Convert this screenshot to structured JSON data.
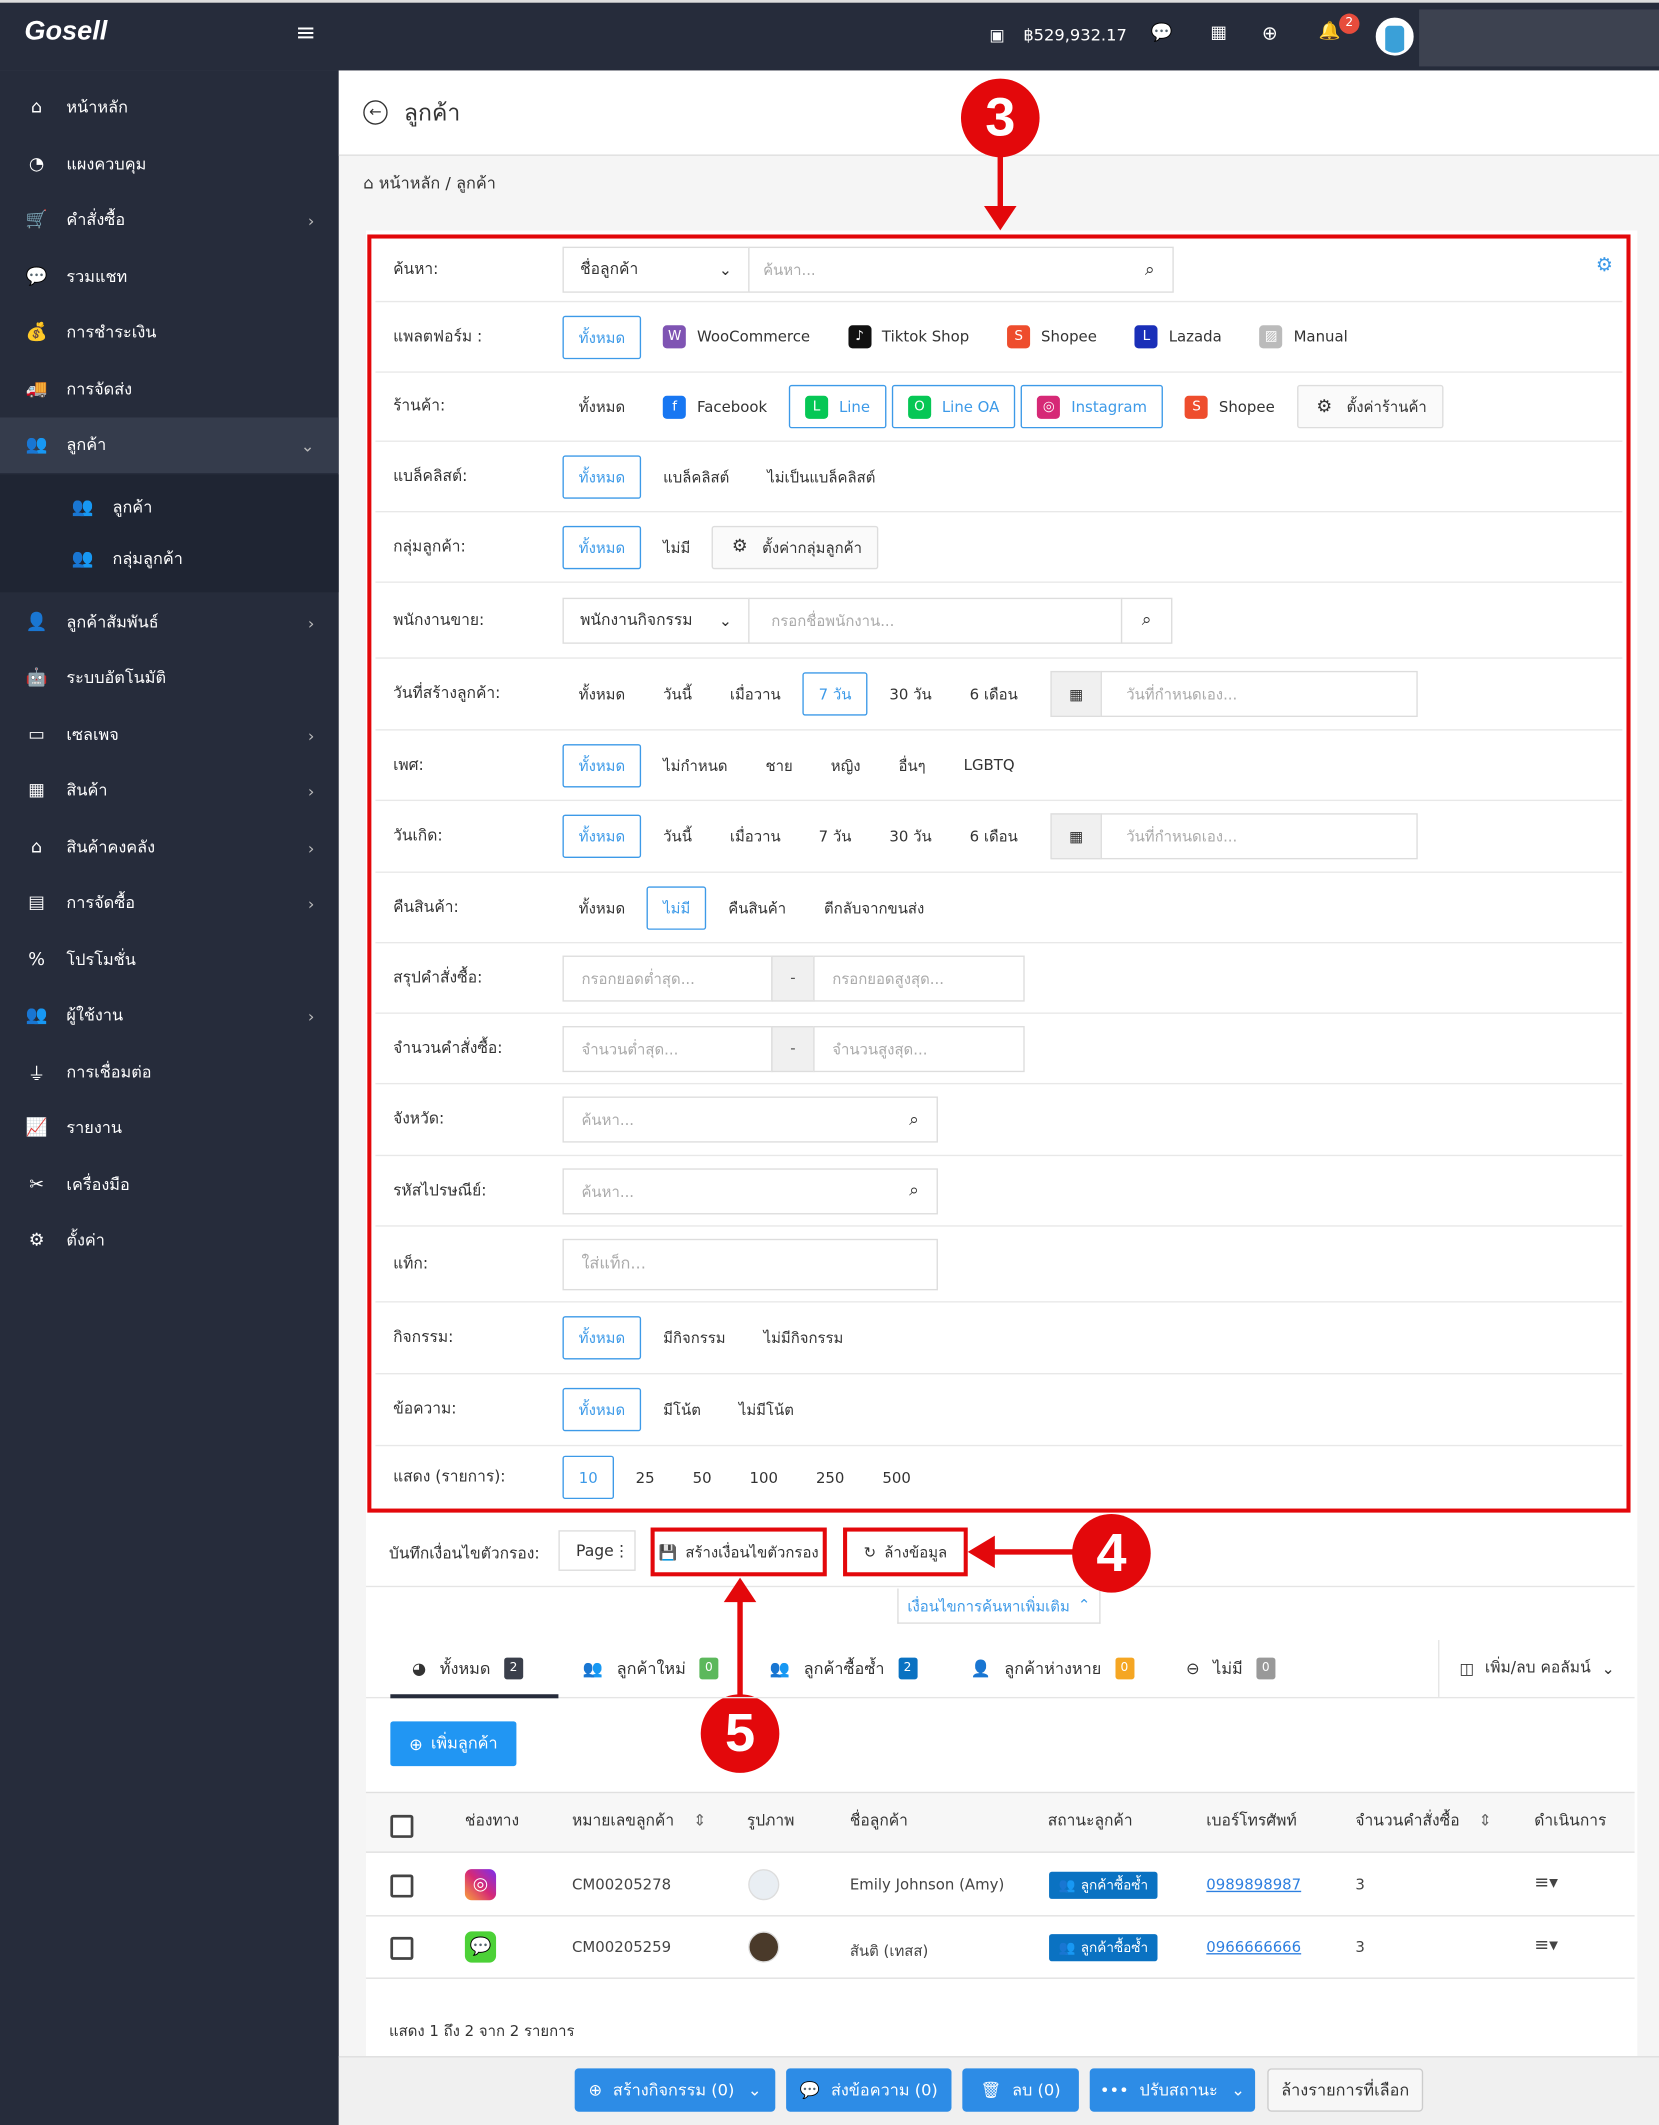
{
  "header": {
    "logo": "Gosell",
    "balance": "฿529,932.17",
    "notification_count": "2"
  },
  "sidebar": {
    "items": [
      {
        "label": "หน้าหลัก",
        "icon": "home-icon",
        "glyph": "⌂"
      },
      {
        "label": "แผงควบคุม",
        "icon": "dashboard-icon",
        "glyph": "◔"
      },
      {
        "label": "คำสั่งซื้อ",
        "icon": "cart-icon",
        "glyph": "🛒",
        "chev": true
      },
      {
        "label": "รวมแชท",
        "icon": "chat-icon",
        "glyph": "💬"
      },
      {
        "label": "การชำระเงิน",
        "icon": "money-icon",
        "glyph": "💰"
      },
      {
        "label": "การจัดส่ง",
        "icon": "truck-icon",
        "glyph": "🚚"
      },
      {
        "label": "ลูกค้า",
        "icon": "users-icon",
        "glyph": "👥",
        "chev": true,
        "active": true
      },
      {
        "label": "ลูกค้า",
        "icon": "users-icon",
        "glyph": "👥",
        "sub": true
      },
      {
        "label": "กลุ่มลูกค้า",
        "icon": "users-cog-icon",
        "glyph": "👥",
        "sub": true
      },
      {
        "label": "ลูกค้าสัมพันธ์",
        "icon": "user-tie-icon",
        "glyph": "👤",
        "chev": true
      },
      {
        "label": "ระบบอัตโนมัติ",
        "icon": "robot-icon",
        "glyph": "🤖"
      },
      {
        "label": "เซลเพจ",
        "icon": "window-icon",
        "glyph": "▭",
        "chev": true
      },
      {
        "label": "สินค้า",
        "icon": "boxes-icon",
        "glyph": "▦",
        "chev": true
      },
      {
        "label": "สินค้าคงคลัง",
        "icon": "warehouse-icon",
        "glyph": "⌂",
        "chev": true
      },
      {
        "label": "การจัดซื้อ",
        "icon": "purchase-icon",
        "glyph": "▤",
        "chev": true
      },
      {
        "label": "โปรโมชั่น",
        "icon": "percent-icon",
        "glyph": "%"
      },
      {
        "label": "ผู้ใช้งาน",
        "icon": "users-gear-icon",
        "glyph": "👥",
        "chev": true
      },
      {
        "label": "การเชื่อมต่อ",
        "icon": "plug-icon",
        "glyph": "⏚"
      },
      {
        "label": "รายงาน",
        "icon": "chart-icon",
        "glyph": "📈"
      },
      {
        "label": "เครื่องมือ",
        "icon": "tools-icon",
        "glyph": "✂"
      },
      {
        "label": "ตั้งค่า",
        "icon": "gear-icon",
        "glyph": "⚙"
      }
    ]
  },
  "page": {
    "title": "ลูกค้า",
    "breadcrumb": "หน้าหลัก / ลูกค้า"
  },
  "filters": [
    {
      "label": "ค้นหา:",
      "type": "select-search",
      "select": "ชื่อลูกค้า",
      "placeholder": "ค้นหา..."
    },
    {
      "label": "แพลตฟอร์ม :",
      "type": "options",
      "options": [
        {
          "label": "ทั้งหมด",
          "on": true
        },
        {
          "label": "WooCommerce",
          "icon": "woocommerce-icon",
          "color": "#7f54b3",
          "g": "W"
        },
        {
          "label": "Tiktok Shop",
          "icon": "tiktok-icon",
          "color": "#111",
          "g": "♪"
        },
        {
          "label": "Shopee",
          "icon": "shopee-icon",
          "color": "#ee4d2d",
          "g": "S"
        },
        {
          "label": "Lazada",
          "icon": "lazada-icon",
          "color": "#1a2fb8",
          "g": "L"
        },
        {
          "label": "Manual",
          "icon": "image-icon",
          "color": "#bbb",
          "g": "▨"
        }
      ]
    },
    {
      "label": "ร้านค้า:",
      "type": "options",
      "options": [
        {
          "label": "ทั้งหมด"
        },
        {
          "label": "Facebook",
          "icon": "facebook-icon",
          "color": "#1877f2",
          "g": "f"
        },
        {
          "label": "Line",
          "icon": "line-icon",
          "color": "#06c755",
          "g": "L",
          "on": true
        },
        {
          "label": "Line OA",
          "icon": "line-oa-icon",
          "color": "#06c755",
          "g": "O",
          "on": true
        },
        {
          "label": "Instagram",
          "icon": "instagram-icon",
          "color": "#d62976",
          "g": "◎",
          "on": true
        },
        {
          "label": "Shopee",
          "icon": "shopee-icon",
          "color": "#ee4d2d",
          "g": "S"
        },
        {
          "label": "ตั้งค่าร้านค้า",
          "icon": "gear-icon",
          "color": "transparent",
          "g": "⚙",
          "btn": true
        }
      ]
    },
    {
      "label": "แบล็คลิสต์:",
      "type": "options",
      "options": [
        {
          "label": "ทั้งหมด",
          "on": true
        },
        {
          "label": "แบล็คลิสต์"
        },
        {
          "label": "ไม่เป็นแบล็คลิสต์"
        }
      ]
    },
    {
      "label": "กลุ่มลูกค้า:",
      "type": "options",
      "options": [
        {
          "label": "ทั้งหมด",
          "on": true
        },
        {
          "label": "ไม่มี"
        },
        {
          "label": "ตั้งค่ากลุ่มลูกค้า",
          "icon": "gear-icon",
          "color": "transparent",
          "g": "⚙",
          "btn": true
        }
      ]
    },
    {
      "label": "พนักงานขาย:",
      "type": "select-search2",
      "select": "พนักงานกิจกรรม",
      "placeholder": "กรอกชื่อพนักงาน..."
    },
    {
      "label": "วันที่สร้างลูกค้า:",
      "type": "options-date",
      "options": [
        {
          "label": "ทั้งหมด"
        },
        {
          "label": "วันนี้"
        },
        {
          "label": "เมื่อวาน"
        },
        {
          "label": "7 วัน",
          "on": true
        },
        {
          "label": "30 วัน"
        },
        {
          "label": "6 เดือน"
        }
      ],
      "placeholder": "วันที่กำหนดเอง..."
    },
    {
      "label": "เพศ:",
      "type": "options",
      "options": [
        {
          "label": "ทั้งหมด",
          "on": true
        },
        {
          "label": "ไม่กำหนด"
        },
        {
          "label": "ชาย"
        },
        {
          "label": "หญิง"
        },
        {
          "label": "อื่นๆ"
        },
        {
          "label": "LGBTQ"
        }
      ]
    },
    {
      "label": "วันเกิด:",
      "type": "options-date",
      "options": [
        {
          "label": "ทั้งหมด",
          "on": true
        },
        {
          "label": "วันนี้"
        },
        {
          "label": "เมื่อวาน"
        },
        {
          "label": "7 วัน"
        },
        {
          "label": "30 วัน"
        },
        {
          "label": "6 เดือน"
        }
      ],
      "placeholder": "วันที่กำหนดเอง..."
    },
    {
      "label": "คืนสินค้า:",
      "type": "options",
      "options": [
        {
          "label": "ทั้งหมด"
        },
        {
          "label": "ไม่มี",
          "on": true
        },
        {
          "label": "คืนสินค้า"
        },
        {
          "label": "ตีกลับจากขนส่ง"
        }
      ]
    },
    {
      "label": "สรุปคำสั่งซื้อ:",
      "type": "range",
      "min": "กรอกยอดต่ำสุด...",
      "max": "กรอกยอดสูงสุด...",
      "sep": "-"
    },
    {
      "label": "จำนวนคำสั่งซื้อ:",
      "type": "range",
      "min": "จำนวนต่ำสุด...",
      "max": "จำนวนสูงสุด...",
      "sep": "-"
    },
    {
      "label": "จังหวัด:",
      "type": "search",
      "placeholder": "ค้นหา..."
    },
    {
      "label": "รหัสไปรษณีย์:",
      "type": "search",
      "placeholder": "ค้นหา..."
    },
    {
      "label": "แท็ก:",
      "type": "input",
      "placeholder": "ใส่แท็ก..."
    },
    {
      "label": "กิจกรรม:",
      "type": "options",
      "options": [
        {
          "label": "ทั้งหมด",
          "on": true
        },
        {
          "label": "มีกิจกรรม"
        },
        {
          "label": "ไม่มีกิจกรรม"
        }
      ]
    },
    {
      "label": "ข้อความ:",
      "type": "options",
      "options": [
        {
          "label": "ทั้งหมด",
          "on": true
        },
        {
          "label": "มีโน้ต"
        },
        {
          "label": "ไม่มีโน้ต"
        }
      ]
    },
    {
      "label": "แสดง (รายการ):",
      "type": "options",
      "options": [
        {
          "label": "10",
          "on": true
        },
        {
          "label": "25"
        },
        {
          "label": "50"
        },
        {
          "label": "100"
        },
        {
          "label": "250"
        },
        {
          "label": "500"
        }
      ]
    }
  ],
  "saved": {
    "label": "บันทึกเงื่อนไขตัวกรอง:",
    "page_select": "Page",
    "create": "สร้างเงื่อนไขตัวกรอง",
    "clear": "ล้างข้อมูล",
    "more": "เงื่อนไขการค้นหาเพิ่มเติม"
  },
  "annotations": [
    "3",
    "4",
    "5"
  ],
  "tabs": [
    {
      "label": "ทั้งหมด",
      "count": "2",
      "color": "#3a3f4b"
    },
    {
      "label": "ลูกค้าใหม่",
      "count": "0",
      "color": "#5cb85c"
    },
    {
      "label": "ลูกค้าซื้อซ้ำ",
      "count": "2",
      "color": "#0a72c2"
    },
    {
      "label": "ลูกค้าห่างหาย",
      "count": "0",
      "color": "#f5a623"
    },
    {
      "label": "ไม่มี",
      "count": "0",
      "color": "#999"
    }
  ],
  "columns_toggle": "เพิ่ม/ลบ คอลัมน์",
  "add_customer": "เพิ่มลูกค้า",
  "table": {
    "headers": [
      "ช่องทาง",
      "หมายเลขลูกค้า",
      "รูปภาพ",
      "ชื่อลูกค้า",
      "สถานะลูกค้า",
      "เบอร์โทรศัพท์",
      "จำนวนคำสั่งซื้อ",
      "ดำเนินการ"
    ],
    "rows": [
      {
        "channel": "instagram",
        "id": "CM00205278",
        "name": "Emily Johnson (Amy)",
        "status": "ลูกค้าซื้อซ้ำ",
        "phone": "0989898987",
        "orders": "3"
      },
      {
        "channel": "line",
        "id": "CM00205259",
        "name": "สันติ (เทสส)",
        "status": "ลูกค้าซื้อซ้ำ",
        "phone": "0966666666",
        "orders": "3"
      }
    ]
  },
  "footer": {
    "summary": "แสดง 1 ถึง 2 จาก 2 รายการ"
  },
  "actions": {
    "create_activity": "สร้างกิจกรรม (0)",
    "send_message": "ส่งข้อความ (0)",
    "delete": "ลบ (0)",
    "update_status": "ปรับสถานะ",
    "clear_selected": "ล้างรายการที่เลือก"
  }
}
